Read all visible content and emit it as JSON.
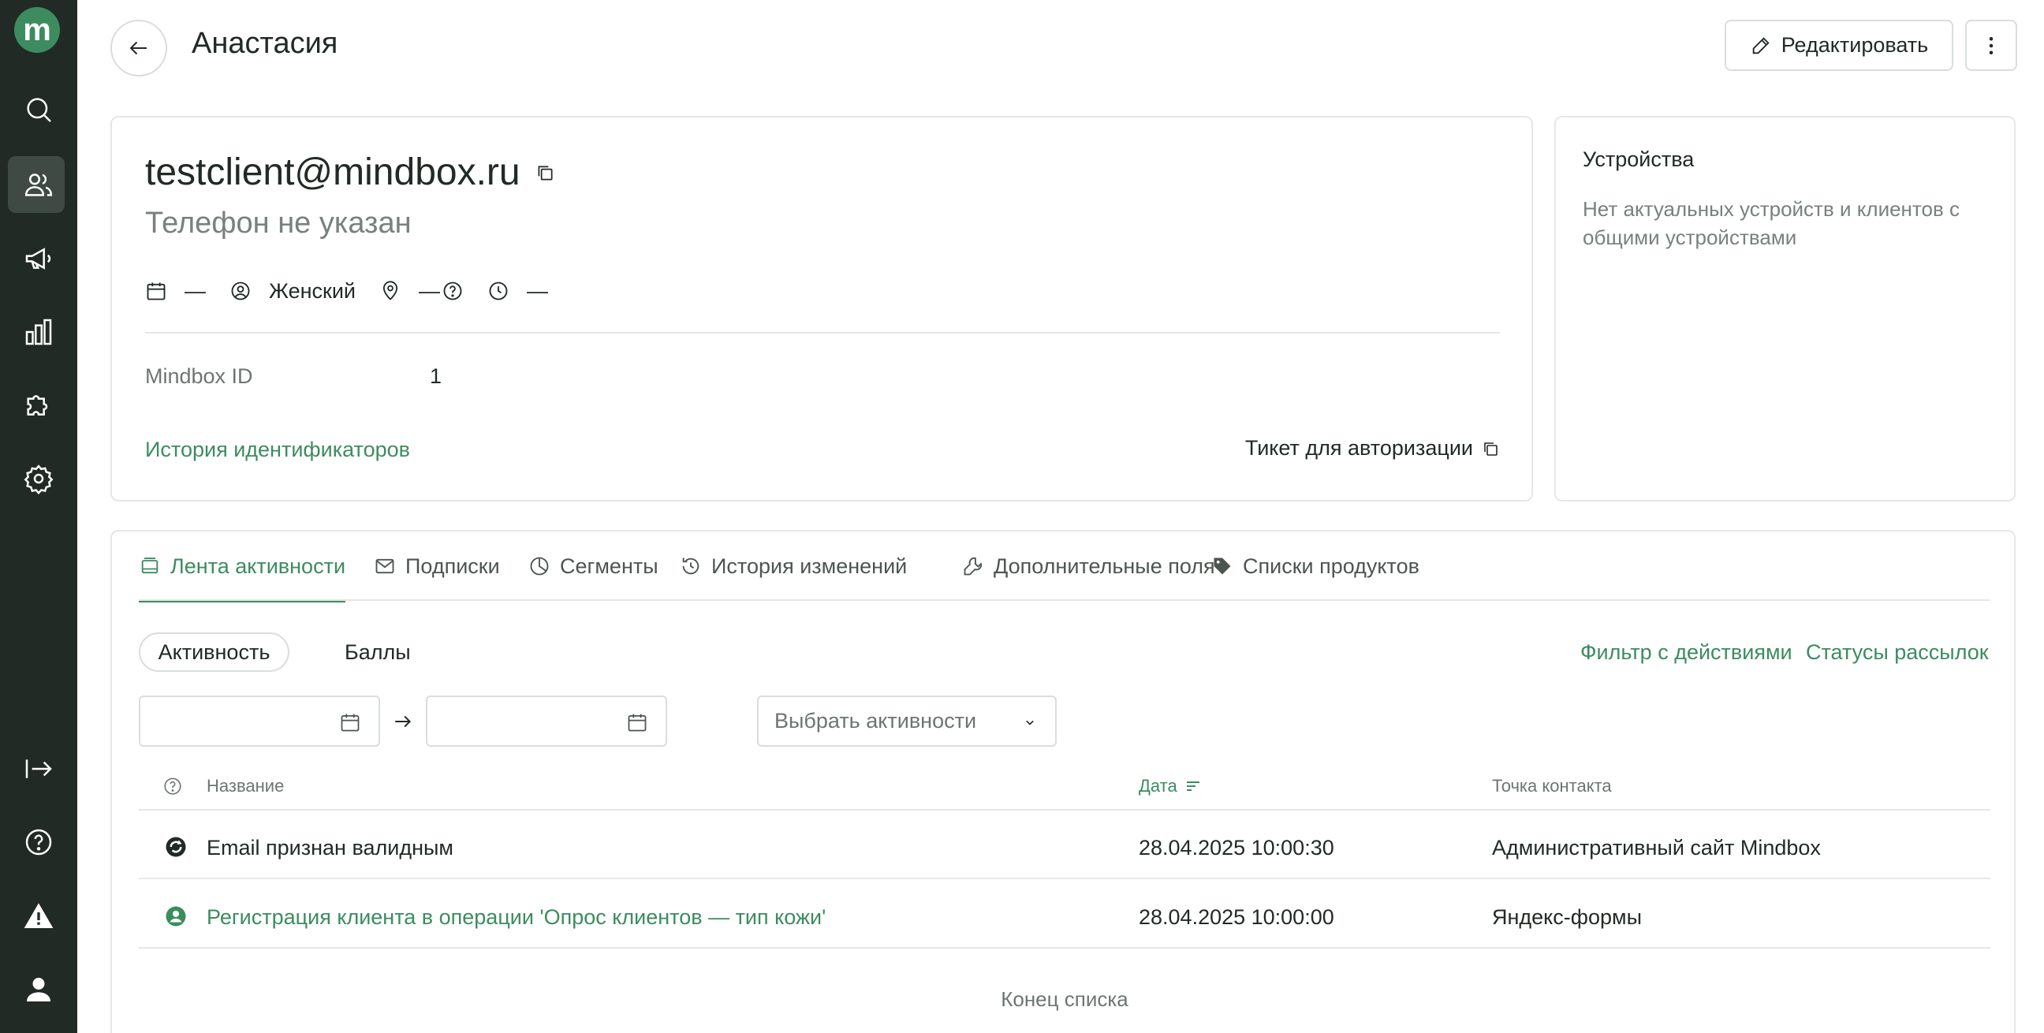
{
  "app": {
    "logo_letter": "m"
  },
  "sidebar": {
    "items": [
      {
        "name": "search",
        "icon": "search-icon"
      },
      {
        "name": "customers",
        "icon": "users-icon",
        "active": true
      },
      {
        "name": "campaigns",
        "icon": "megaphone-icon"
      },
      {
        "name": "analytics",
        "icon": "bar-chart-icon"
      },
      {
        "name": "integrations",
        "icon": "puzzle-icon"
      },
      {
        "name": "settings",
        "icon": "gear-icon"
      },
      {
        "name": "logout",
        "icon": "exit-icon"
      },
      {
        "name": "help",
        "icon": "help-icon"
      },
      {
        "name": "alerts",
        "icon": "warning-icon"
      },
      {
        "name": "profile",
        "icon": "user-icon"
      }
    ]
  },
  "header": {
    "title": "Анастасия",
    "edit_label": "Редактировать"
  },
  "profile": {
    "email": "testclient@mindbox.ru",
    "phone": "Телефон не указан",
    "birthday": "—",
    "gender": "Женский",
    "location": "—",
    "timezone": "—",
    "id_label": "Mindbox ID",
    "id_value": "1",
    "id_history_link": "История идентификаторов",
    "ticket_label": "Тикет для авторизации"
  },
  "devices": {
    "title": "Устройства",
    "empty_text": "Нет актуальных устройств и клиентов с общими устройствами"
  },
  "tabs": [
    {
      "label": "Лента активности",
      "icon": "feed-icon",
      "active": true
    },
    {
      "label": "Подписки",
      "icon": "mail-icon"
    },
    {
      "label": "Сегменты",
      "icon": "pie-icon"
    },
    {
      "label": "История изменений",
      "icon": "history-icon"
    },
    {
      "label": "Дополнительные поля",
      "icon": "wrench-icon"
    },
    {
      "label": "Списки продуктов",
      "icon": "tag-icon"
    }
  ],
  "activity": {
    "filter_active": "Активность",
    "filter_points": "Баллы",
    "filter_actions_link": "Фильтр с действиями",
    "mailing_status_link": "Статусы рассылок",
    "date_from": "",
    "date_to": "",
    "select_placeholder": "Выбрать активности",
    "columns": {
      "name": "Название",
      "date": "Дата",
      "contact": "Точка контакта"
    },
    "rows": [
      {
        "name": "Email признан валидным",
        "date": "28.04.2025 10:00:30",
        "contact": "Административный сайт Mindbox",
        "icon": "sync-icon",
        "link": false
      },
      {
        "name": "Регистрация клиента в операции 'Опрос клиентов — тип кожи'",
        "date": "28.04.2025 10:00:00",
        "contact": "Яндекс-формы",
        "icon": "user-circle-icon",
        "link": true
      }
    ],
    "end_text": "Конец списка"
  },
  "colors": {
    "accent": "#3c8c5f",
    "sidebar": "#222a25",
    "text": "#222a25",
    "muted": "#79817c",
    "border": "#e4e8e5"
  }
}
